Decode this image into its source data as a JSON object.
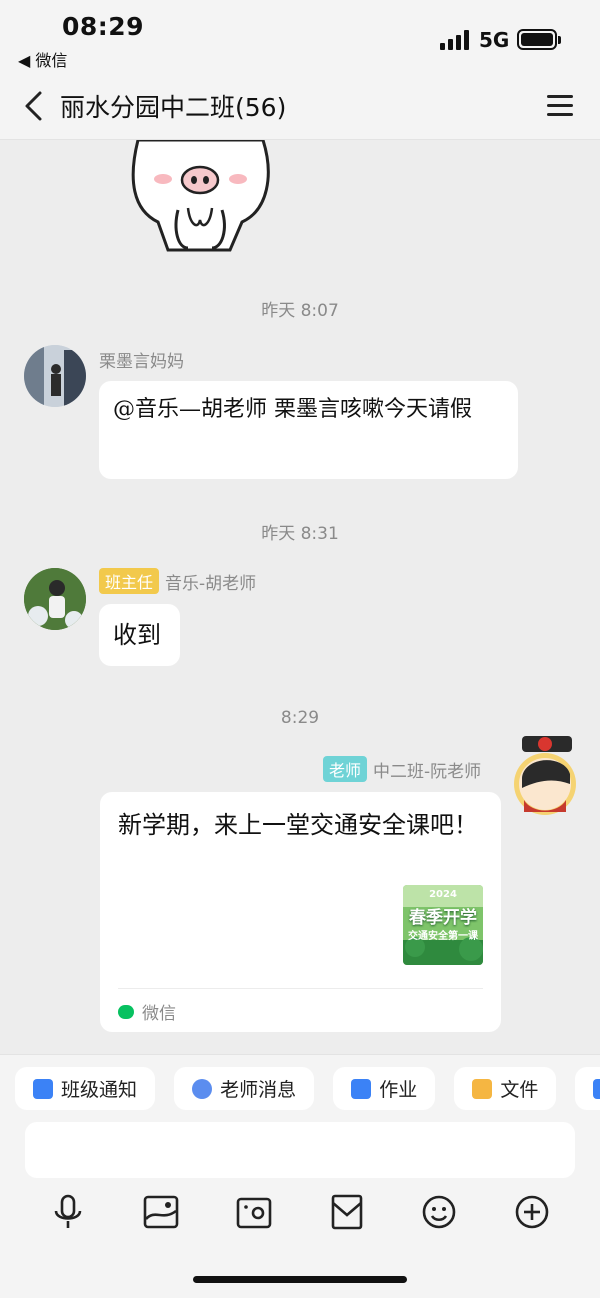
{
  "status_bar": {
    "time": "08:29",
    "back_app": "◀ 微信",
    "network": "5G"
  },
  "nav": {
    "title": "丽水分园中二班(56)"
  },
  "messages": [
    {
      "type": "timestamp",
      "text": "昨天 8:07"
    },
    {
      "type": "incoming",
      "sender": "栗墨言妈妈",
      "text": "@音乐—胡老师 栗墨言咳嗽今天请假"
    },
    {
      "type": "timestamp",
      "text": "昨天 8:31"
    },
    {
      "type": "incoming",
      "badge": "班主任",
      "sender": "音乐-胡老师",
      "text": "收到"
    },
    {
      "type": "timestamp",
      "text": "8:29"
    },
    {
      "type": "outgoing_card",
      "badge": "老师",
      "sender": "中二班-阮老师",
      "text": "新学期，来上一堂交通安全课吧！",
      "thumb_title": "春季开学",
      "thumb_sub": "交通安全第一课",
      "thumb_year": "2024",
      "source": "微信"
    }
  ],
  "shortcuts": [
    "班级通知",
    "老师消息",
    "作业",
    "文件"
  ],
  "toolbar_icons": [
    "microphone-icon",
    "image-icon",
    "camera-icon",
    "envelope-icon",
    "emoji-icon",
    "plus-circle-icon"
  ],
  "colors": {
    "badge_headteacher": "#f2c94c",
    "badge_teacher": "#6fd3d6",
    "wechat_green": "#07c160"
  }
}
